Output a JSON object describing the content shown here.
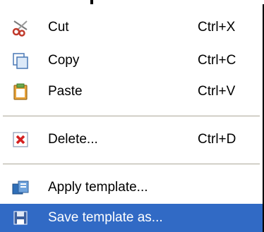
{
  "menu": {
    "items": [
      {
        "label": "Cut",
        "shortcut": "Ctrl+X",
        "icon": "scissors-icon"
      },
      {
        "label": "Copy",
        "shortcut": "Ctrl+C",
        "icon": "copy-icon"
      },
      {
        "label": "Paste",
        "shortcut": "Ctrl+V",
        "icon": "paste-icon"
      },
      {
        "label": "Delete...",
        "shortcut": "Ctrl+D",
        "icon": "delete-icon"
      },
      {
        "label": "Apply template...",
        "shortcut": "",
        "icon": "apply-template-icon"
      },
      {
        "label": "Save template as...",
        "shortcut": "",
        "icon": "save-icon",
        "highlighted": true
      }
    ]
  },
  "colors": {
    "highlight_bg": "#316ac5",
    "highlight_text": "#ffffff",
    "separator": "#aca899",
    "delete_red": "#d42020"
  }
}
